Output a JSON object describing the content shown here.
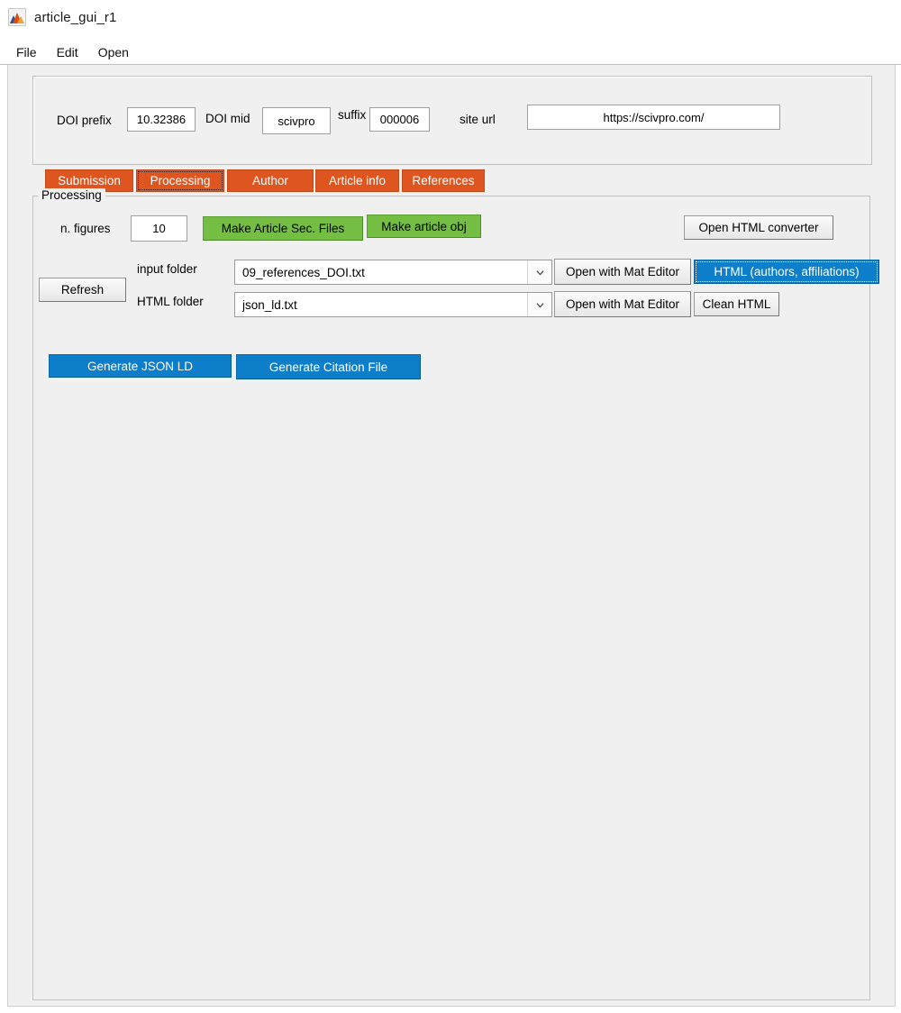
{
  "window": {
    "title": "article_gui_r1",
    "icon": "matlab-membrane-icon"
  },
  "menubar": {
    "items": [
      {
        "label": "File"
      },
      {
        "label": "Edit"
      },
      {
        "label": "Open"
      }
    ]
  },
  "doi_panel": {
    "prefix_label": "DOI prefix",
    "prefix_value": "10.32386",
    "mid_label": "DOI mid",
    "mid_value": "scivpro",
    "suffix_label": "suffix",
    "suffix_value": "000006",
    "site_url_label": "site url",
    "site_url_value": "https://scivpro.com/"
  },
  "tabs": {
    "selected": "Processing",
    "items": [
      {
        "label": "Submission"
      },
      {
        "label": "Processing"
      },
      {
        "label": "Author"
      },
      {
        "label": "Article info"
      },
      {
        "label": "References"
      }
    ]
  },
  "processing": {
    "panel_title": "Processing",
    "n_figures_label": "n. figures",
    "n_figures_value": "10",
    "make_article_sec_files_label": "Make Article Sec. Files",
    "make_article_obj_label": "Make article obj",
    "open_html_converter_label": "Open HTML converter",
    "refresh_label": "Refresh",
    "input_folder_label": "input folder",
    "input_folder_value": "09_references_DOI.txt",
    "html_folder_label": "HTML folder",
    "html_folder_value": "json_ld.txt",
    "open_with_mat_editor_label_1": "Open with Mat Editor",
    "open_with_mat_editor_label_2": "Open with Mat Editor",
    "html_authors_affiliations_label": "HTML (authors, affiliations)",
    "clean_html_label": "Clean HTML",
    "generate_json_ld_label": "Generate JSON LD",
    "generate_citation_file_label": "Generate Citation File"
  },
  "colors": {
    "tab_orange": "#de551f",
    "button_green": "#74bf43",
    "button_blue": "#0d7ec9",
    "figure_background": "#f0f0f0"
  }
}
